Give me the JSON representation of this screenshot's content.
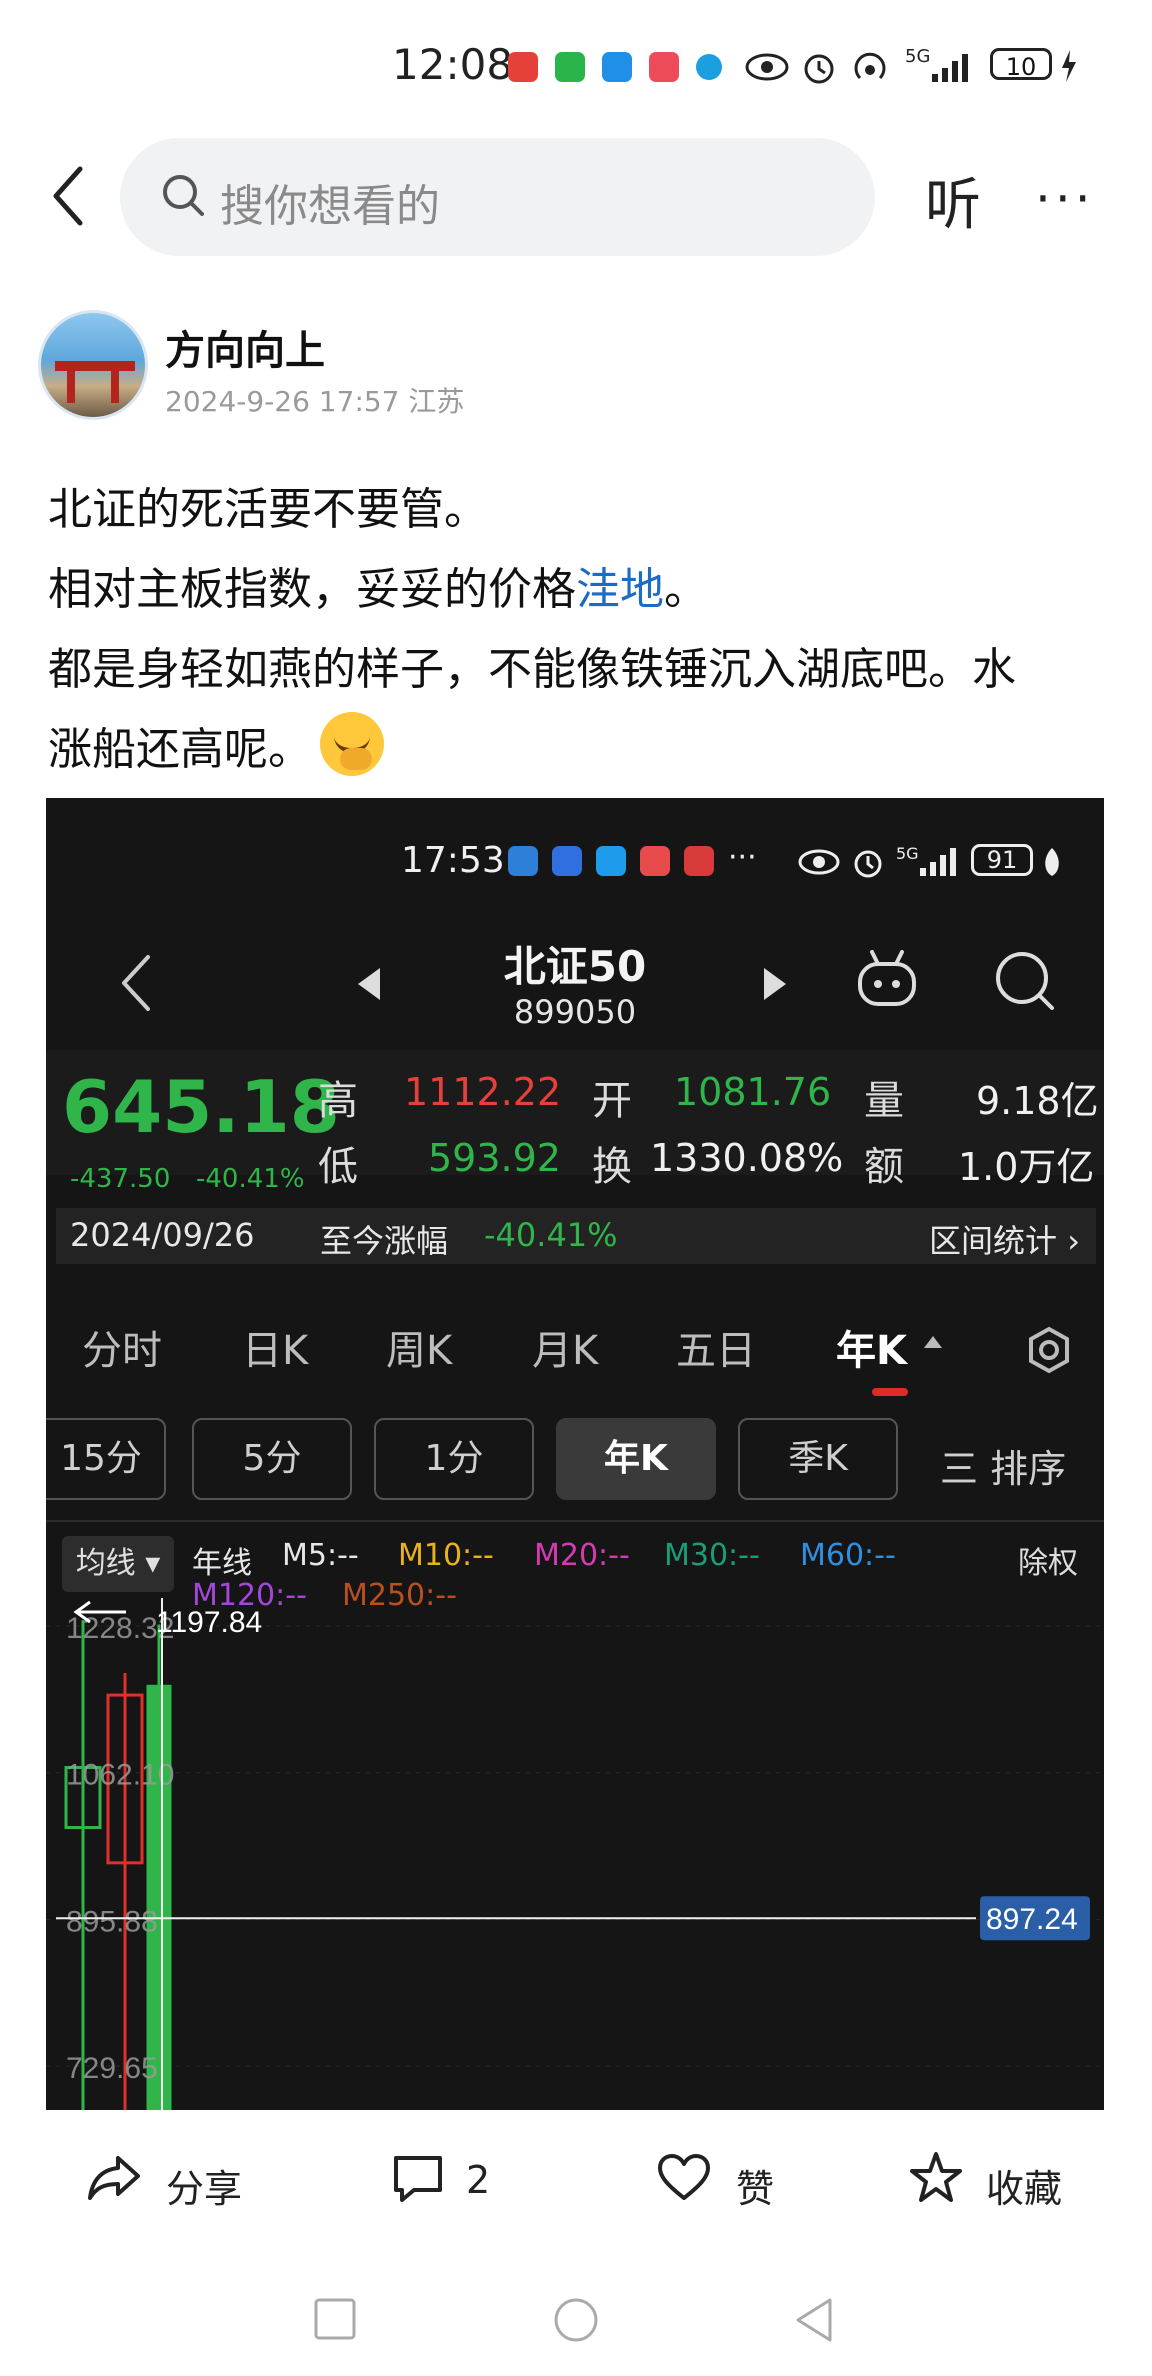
{
  "status_bar": {
    "time": "12:08",
    "signal_label": "5G",
    "battery": "10"
  },
  "search": {
    "placeholder": "搜你想看的"
  },
  "header": {
    "listen_label": "听",
    "more_label": "···"
  },
  "author": {
    "name": "方向向上",
    "meta": "2024-9-26 17:57 江苏"
  },
  "post": {
    "line1": "北证的死活要不要管。",
    "line2_prefix": "相对主板指数，妥妥的价格",
    "line2_link": "洼地",
    "line2_suffix": "。",
    "line3": "都是身轻如燕的样子，不能像铁锤沉入湖底吧。水",
    "line4": "涨船还高呢。"
  },
  "screenshot": {
    "time": "17:53",
    "signal_label": "5G",
    "battery": "91",
    "title": "北证50",
    "code": "899050",
    "quote": {
      "price": "645.18",
      "change": "-437.50",
      "change_pct": "-40.41%",
      "high_label": "高",
      "high": "1112.22",
      "open_label": "开",
      "open": "1081.76",
      "volume_label": "量",
      "volume": "9.18亿",
      "low_label": "低",
      "low": "593.92",
      "turnover_label": "换",
      "turnover": "1330.08%",
      "amount_label": "额",
      "amount": "1.0万亿"
    },
    "date_bar": {
      "date": "2024/09/26",
      "since_label": "至今涨幅",
      "since_value": "-40.41%",
      "stats_label": "区间统计 ›"
    },
    "tabs": [
      "分时",
      "日K",
      "周K",
      "月K",
      "五日",
      "年K"
    ],
    "active_tab": "年K",
    "periods": [
      "15分",
      "5分",
      "1分",
      "年K",
      "季K"
    ],
    "active_period": "年K",
    "sort_label": "三 排序",
    "ma_select": "均线 ▾",
    "ma_items": [
      {
        "label": "年线",
        "color": "#e6e6e6"
      },
      {
        "label": "M5:--",
        "color": "#e6e6e6"
      },
      {
        "label": "M10:--",
        "color": "#e8b21e"
      },
      {
        "label": "M20:--",
        "color": "#d33bb3"
      },
      {
        "label": "M30:--",
        "color": "#1d9c78"
      },
      {
        "label": "M60:--",
        "color": "#2f8fe0"
      },
      {
        "label": "M120:--",
        "color": "#a447d8"
      },
      {
        "label": "M250:--",
        "color": "#b8501f"
      }
    ],
    "adjust_label": "除权",
    "chart_data": {
      "type": "candlestick",
      "y_ticks": [
        "1228.32",
        "1062.10",
        "895.88",
        "729.65"
      ],
      "ylim": [
        680,
        1260
      ],
      "crosshair_top_label": "1197.84",
      "crosshair_price": "897.24",
      "candles": [
        {
          "open": 1000,
          "close": 1068,
          "high": 1235,
          "low": 680,
          "color": "#2fb54a"
        },
        {
          "open": 960,
          "close": 1150,
          "high": 1175,
          "low": 680,
          "color": "#e0302a"
        },
        {
          "open": 1160,
          "close": 680,
          "high": 1230,
          "low": 680,
          "color": "#2fb54a"
        }
      ]
    }
  },
  "actions": {
    "share_label": "分享",
    "comment_count": "2",
    "like_label": "赞",
    "favorite_label": "收藏"
  }
}
